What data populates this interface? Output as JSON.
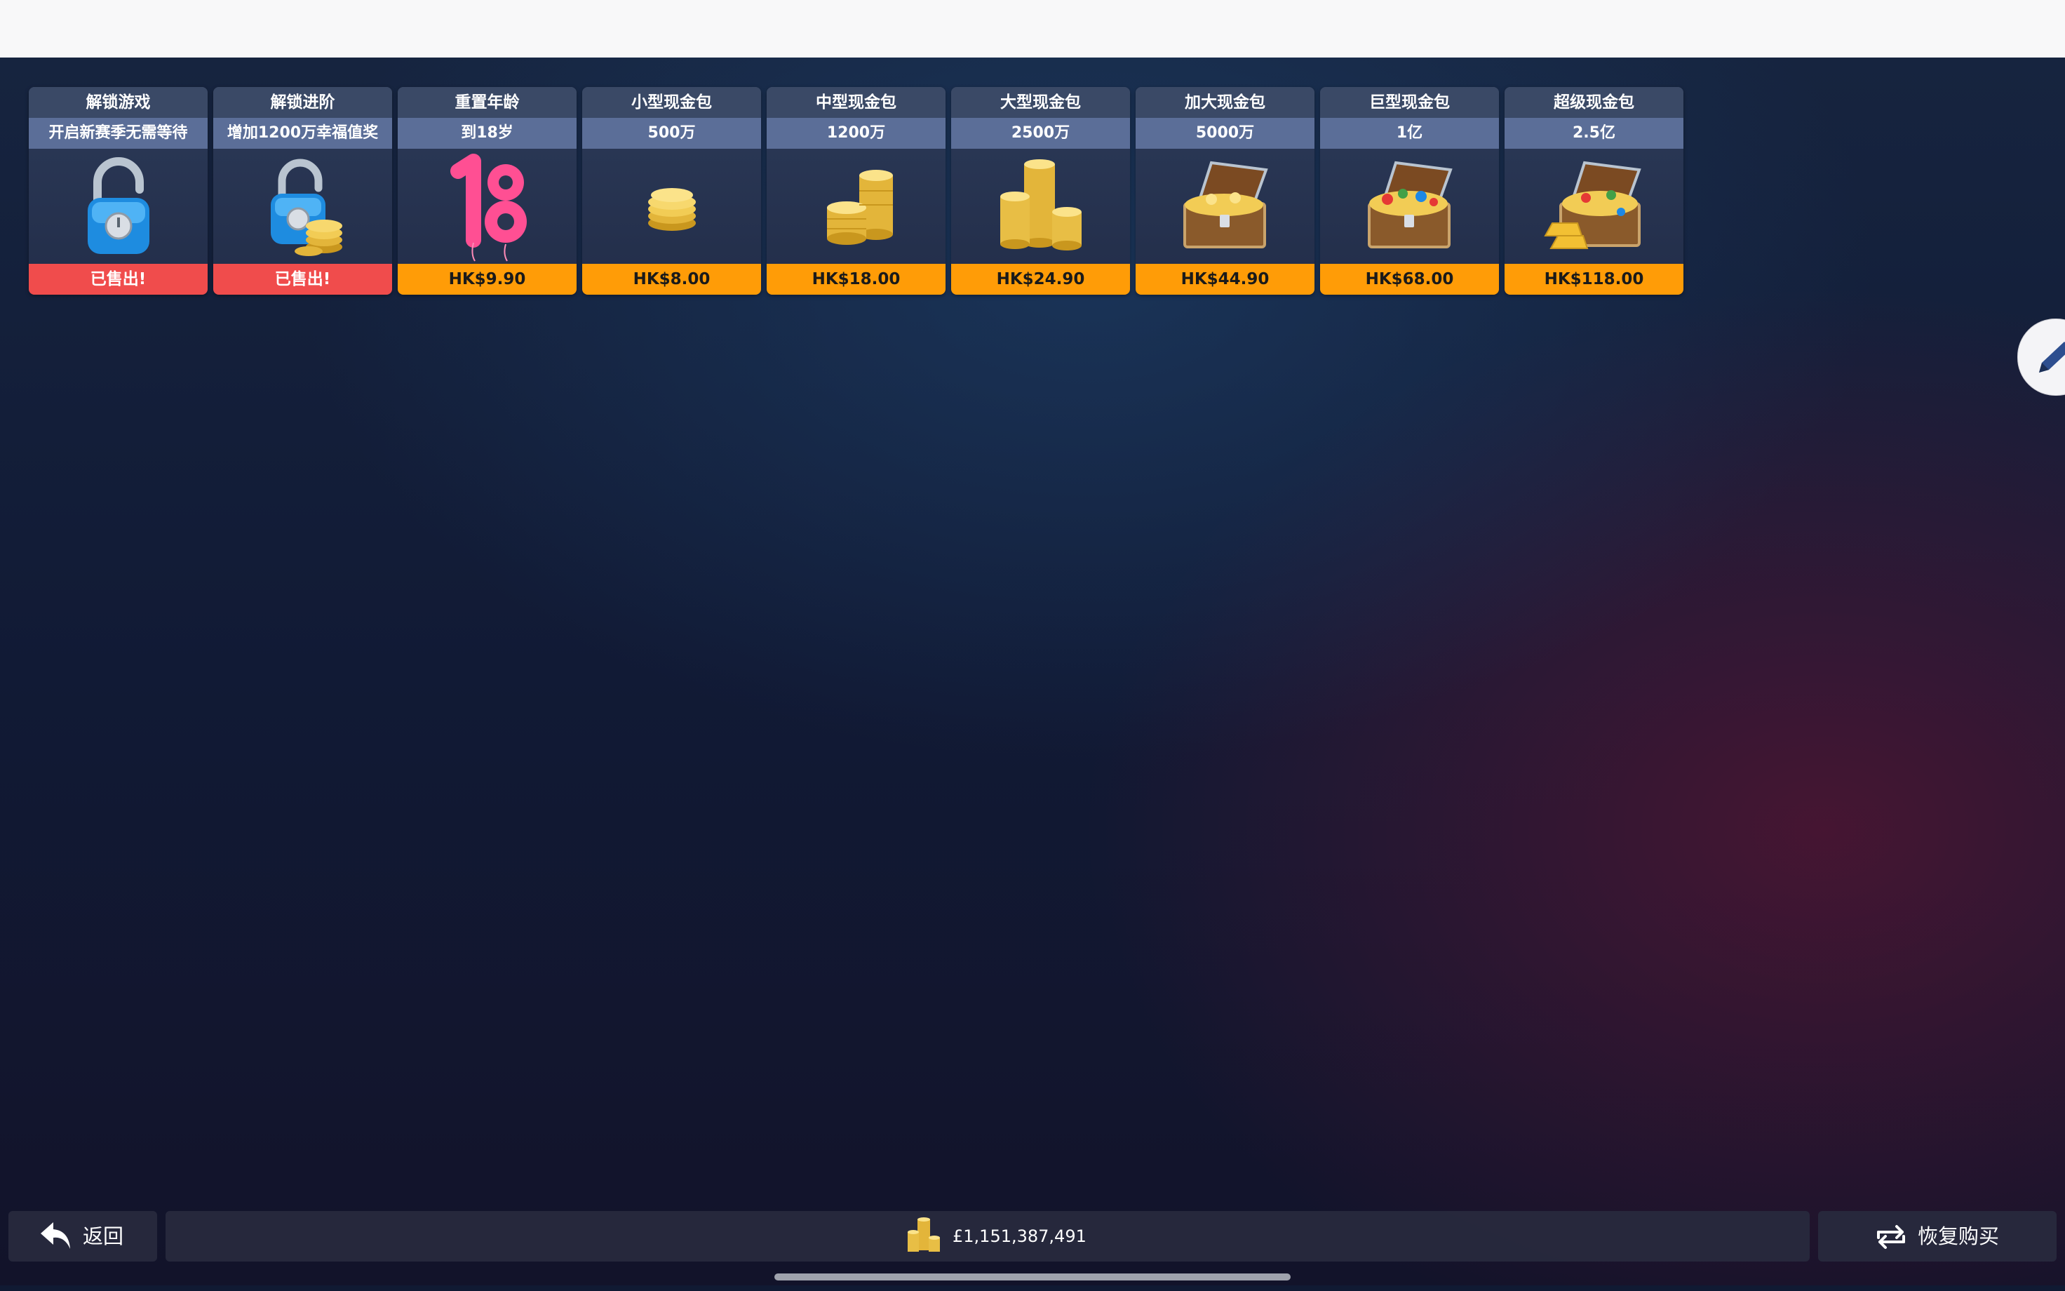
{
  "store": {
    "items": [
      {
        "title": "解锁游戏",
        "subtitle": "开启新赛季无需等待",
        "price": "已售出!",
        "sold": true,
        "icon": "padlock-open-icon"
      },
      {
        "title": "解锁进阶",
        "subtitle": "增加1200万幸福值奖",
        "price": "已售出!",
        "sold": true,
        "icon": "padlock-coins-icon"
      },
      {
        "title": "重置年龄",
        "subtitle": "到18岁",
        "price": "HK$9.90",
        "sold": false,
        "icon": "balloon-18-icon"
      },
      {
        "title": "小型现金包",
        "subtitle": "500万",
        "price": "HK$8.00",
        "sold": false,
        "icon": "small-coin-stack-icon"
      },
      {
        "title": "中型现金包",
        "subtitle": "1200万",
        "price": "HK$18.00",
        "sold": false,
        "icon": "medium-coin-stack-icon"
      },
      {
        "title": "大型现金包",
        "subtitle": "2500万",
        "price": "HK$24.90",
        "sold": false,
        "icon": "large-coin-stack-icon"
      },
      {
        "title": "加大现金包",
        "subtitle": "5000万",
        "price": "HK$44.90",
        "sold": false,
        "icon": "treasure-chest-gold-icon"
      },
      {
        "title": "巨型现金包",
        "subtitle": "1亿",
        "price": "HK$68.00",
        "sold": false,
        "icon": "treasure-chest-gems-icon"
      },
      {
        "title": "超级现金包",
        "subtitle": "2.5亿",
        "price": "HK$118.00",
        "sold": false,
        "icon": "treasure-chest-gold-bars-icon"
      }
    ]
  },
  "footer": {
    "back_label": "返回",
    "balance": "£1,151,387,491",
    "restore_label": "恢复购买"
  },
  "colors": {
    "price_orange": "#ff9c07",
    "sold_red": "#f04c4c",
    "card_header": "#3a4966",
    "card_subheader": "#5b6e98"
  }
}
